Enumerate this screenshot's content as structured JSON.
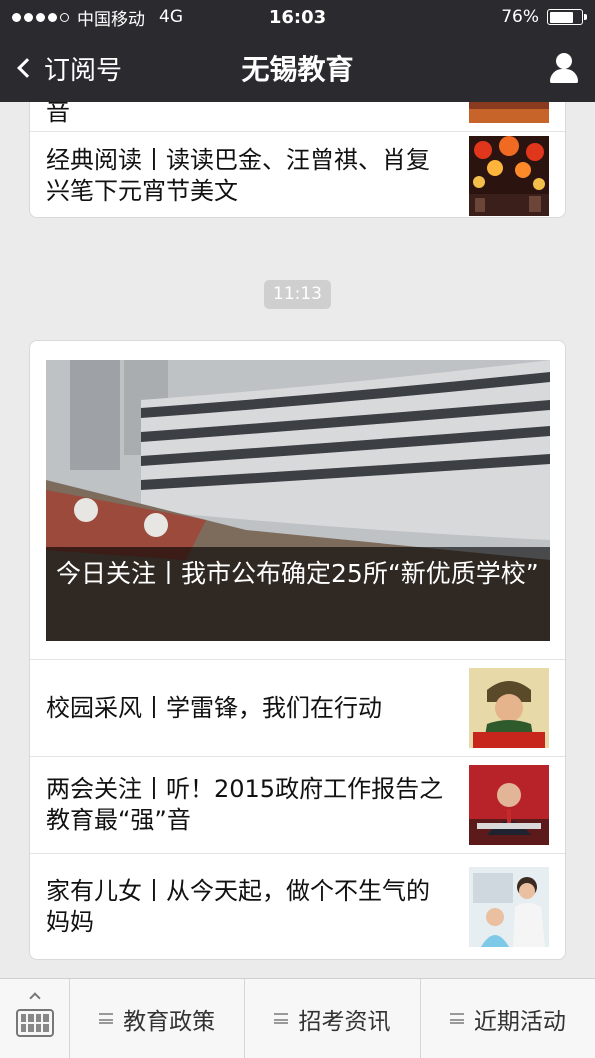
{
  "status_bar": {
    "signal_dots_filled": 4,
    "signal_dots_total": 5,
    "carrier": "中国移动",
    "network": "4G",
    "time": "16:03",
    "battery_text": "76%",
    "battery_level": 0.76
  },
  "nav": {
    "back_label": "订阅号",
    "title": "无锡教育"
  },
  "feed": {
    "card1": {
      "partial_item_text": "音",
      "item": {
        "title": "经典阅读丨读读巴金、汪曾祺、肖复兴笔下元宵节美文",
        "thumb_icon": "lanterns-photo"
      }
    },
    "timestamp": "11:13",
    "card2": {
      "hero_caption": "今日关注丨我市公布确定25所“新优质学校”",
      "items": [
        {
          "title": "校园采风丨学雷锋，我们在行动",
          "thumb_icon": "lei-feng-poster"
        },
        {
          "title": "两会关注丨听！2015政府工作报告之教育最“强”音",
          "thumb_icon": "official-speech-photo"
        },
        {
          "title": "家有儿女丨从今天起，做个不生气的妈妈",
          "thumb_icon": "mother-child-photo"
        }
      ]
    }
  },
  "bottom_menu": {
    "items": [
      "教育政策",
      "招考资讯",
      "近期活动"
    ]
  }
}
